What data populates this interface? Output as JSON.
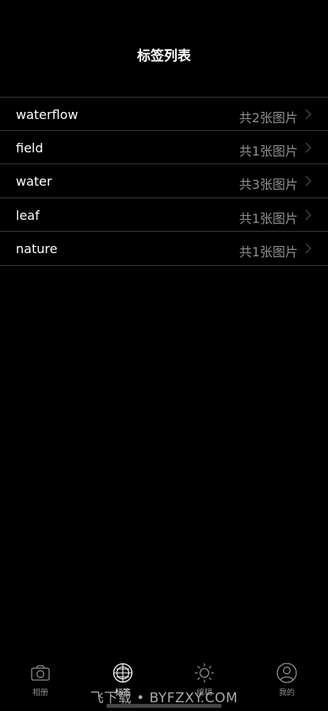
{
  "header": {
    "title": "标签列表"
  },
  "tags": [
    {
      "name": "waterflow",
      "count": "共2张图片"
    },
    {
      "name": "field",
      "count": "共1张图片"
    },
    {
      "name": "water",
      "count": "共3张图片"
    },
    {
      "name": "leaf",
      "count": "共1张图片"
    },
    {
      "name": "nature",
      "count": "共1张图片"
    }
  ],
  "tabbar": {
    "items": [
      {
        "label": "相册",
        "icon": "camera-icon",
        "active": false
      },
      {
        "label": "标签",
        "icon": "tag-globe-icon",
        "active": true
      },
      {
        "label": "编辑",
        "icon": "sun-icon",
        "active": false
      },
      {
        "label": "我的",
        "icon": "user-icon",
        "active": false
      }
    ]
  },
  "watermark": "飞下载 • BYFZXY.COM",
  "colors": {
    "background": "#000000",
    "text_primary": "#ffffff",
    "text_secondary": "#8e8e93",
    "separator": "#3a3a3c"
  }
}
